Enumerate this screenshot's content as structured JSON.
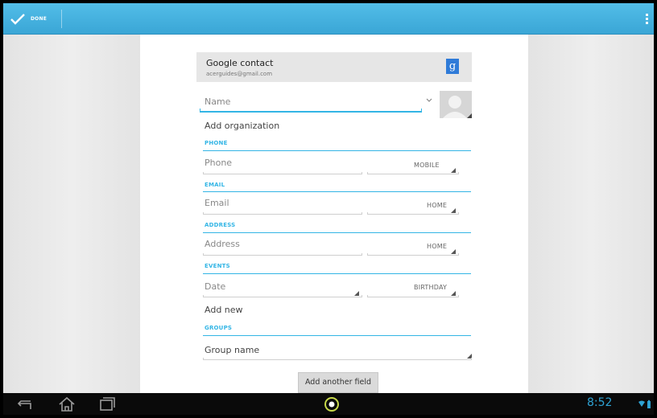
{
  "action_bar": {
    "done_label": "DONE"
  },
  "account": {
    "title": "Google contact",
    "email": "acerguides@gmail.com",
    "badge": "g"
  },
  "form": {
    "name_placeholder": "Name",
    "add_organization": "Add organization",
    "sections": {
      "phone": {
        "header": "PHONE",
        "placeholder": "Phone",
        "type": "MOBILE"
      },
      "email": {
        "header": "EMAIL",
        "placeholder": "Email",
        "type": "HOME"
      },
      "address": {
        "header": "ADDRESS",
        "placeholder": "Address",
        "type": "HOME"
      },
      "events": {
        "header": "EVENTS",
        "placeholder": "Date",
        "type": "BIRTHDAY",
        "add_new": "Add new"
      },
      "groups": {
        "header": "GROUPS",
        "placeholder": "Group name"
      }
    },
    "add_field_button": "Add another field"
  },
  "status_bar": {
    "time": "8:52"
  },
  "colors": {
    "accent": "#33b5e5",
    "action_bar": "#3aa6d6",
    "clock": "#2ea3d4"
  },
  "icons": [
    "check-icon",
    "overflow-menu-icon",
    "google-plus-icon",
    "chevron-down-icon",
    "contact-photo-icon",
    "back-icon",
    "home-icon",
    "recent-apps-icon",
    "app-launcher-icon",
    "wifi-icon",
    "battery-icon"
  ]
}
